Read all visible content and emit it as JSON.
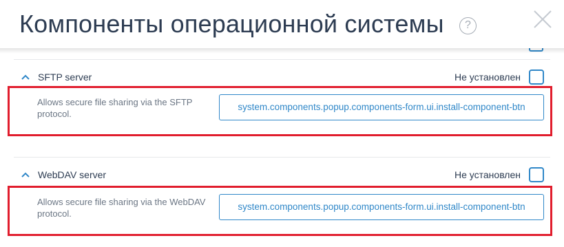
{
  "header": {
    "title": "Компоненты операционной системы",
    "help_glyph": "?",
    "help_icon": "question-circle-icon",
    "close_icon": "close-icon"
  },
  "components": [
    {
      "name": "SFTP server",
      "status": "Не установлен",
      "description": "Allows secure file sharing via the SFTP protocol.",
      "install_button_label": "system.components.popup.components-form.ui.install-component-btn",
      "checked": false,
      "expanded": true
    },
    {
      "name": "WebDAV server",
      "status": "Не установлен",
      "description": "Allows secure file sharing via the WebDAV protocol.",
      "install_button_label": "system.components.popup.components-form.ui.install-component-btn",
      "checked": false,
      "expanded": true
    }
  ],
  "colors": {
    "accent": "#2f87c8",
    "title": "#2d3c52",
    "highlight_border": "#e11d2d",
    "muted_text": "#6b7684"
  }
}
